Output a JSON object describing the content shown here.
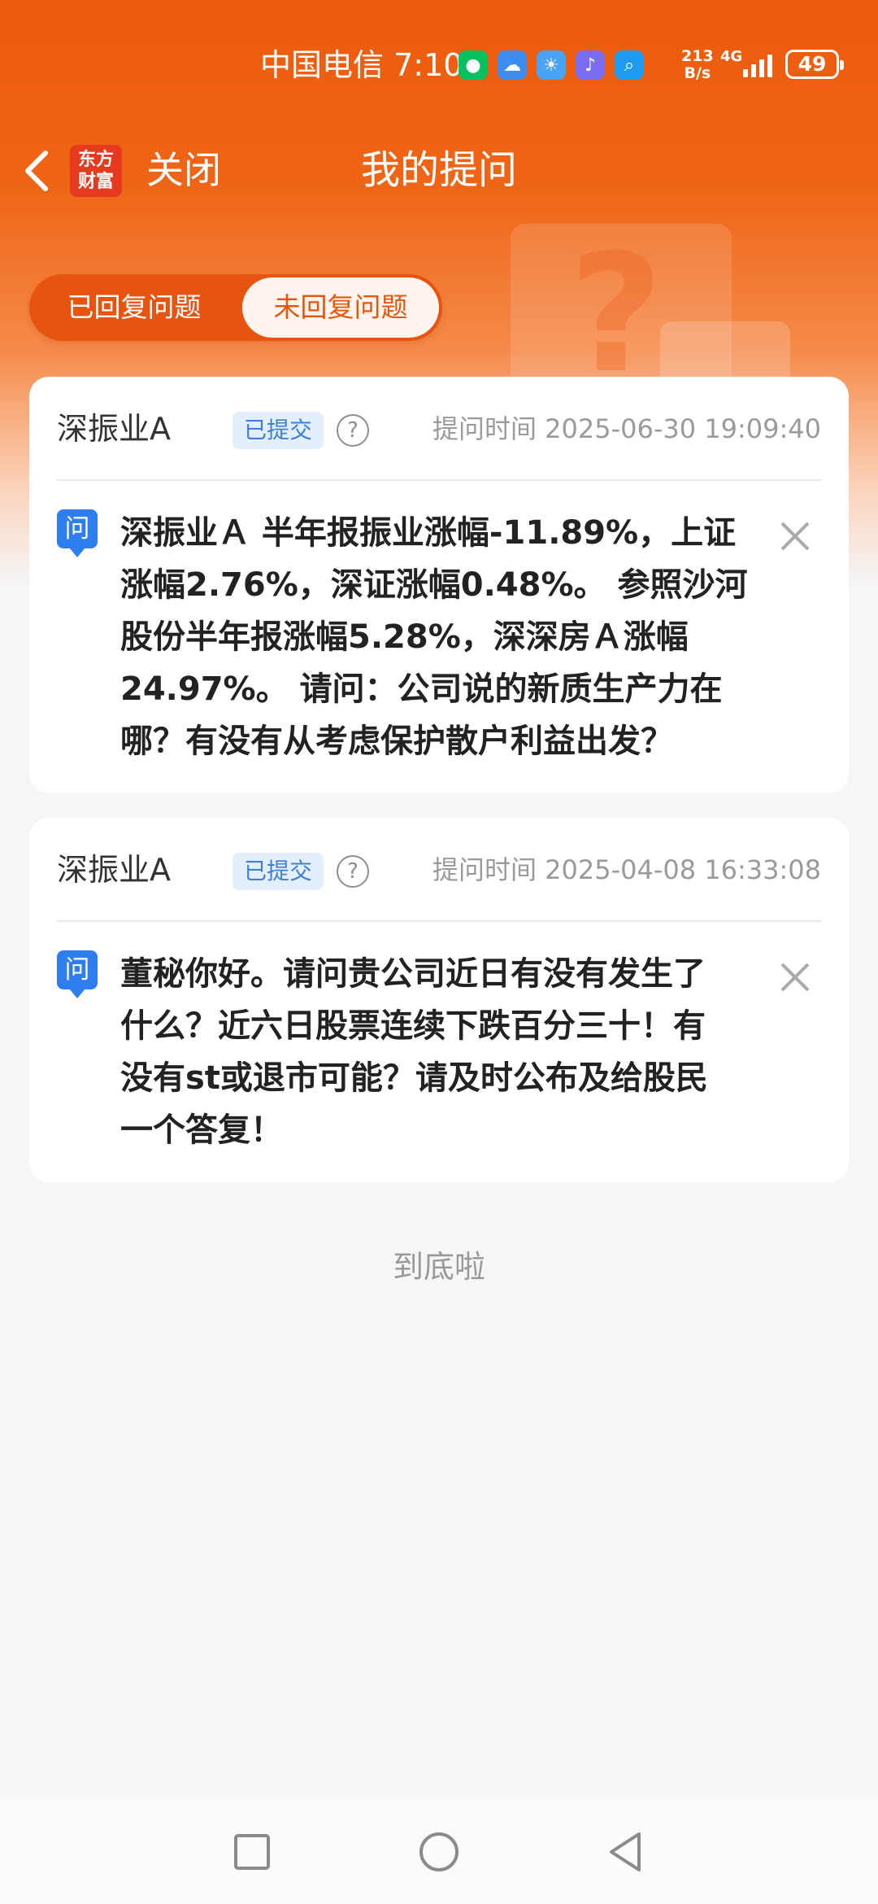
{
  "status_bar": {
    "carrier": "中国电信",
    "time": "7:10",
    "speed_value": "213",
    "speed_unit": "B/s",
    "network": "4G",
    "battery": "49"
  },
  "nav": {
    "logo_line1": "东方",
    "logo_line2": "财富",
    "close_label": "关闭",
    "title": "我的提问"
  },
  "tabs": [
    {
      "label": "已回复问题",
      "active": false
    },
    {
      "label": "未回复问题",
      "active": true
    }
  ],
  "questions": [
    {
      "company": "深振业A",
      "status": "已提交",
      "help": "?",
      "time_label": "提问时间",
      "time": "2025-06-30 19:09:40",
      "icon_label": "问",
      "lines": [
        "深振业Ａ 半年报振业涨幅-11.89%，上证",
        "涨幅2.76%，深证涨幅0.48%。 参照沙河",
        "股份半年报涨幅5.28%，深深房Ａ涨幅",
        "24.97%。 请问：公司说的新质生产力在",
        "哪？有没有从考虑保护散户利益出发？"
      ]
    },
    {
      "company": "深振业A",
      "status": "已提交",
      "help": "?",
      "time_label": "提问时间",
      "time": "2025-04-08 16:33:08",
      "icon_label": "问",
      "lines": [
        "董秘你好。请问贵公司近日有没有发生了",
        "什么？近六日股票连续下跌百分三十！有",
        "没有st或退市可能？请及时公布及给股民",
        "一个答复！"
      ]
    }
  ],
  "footer": {
    "end_text": "到底啦"
  },
  "colors": {
    "brand_orange": "#ec5a0e",
    "badge_blue": "#3f7fd8",
    "question_icon_blue": "#2e7ef0"
  }
}
